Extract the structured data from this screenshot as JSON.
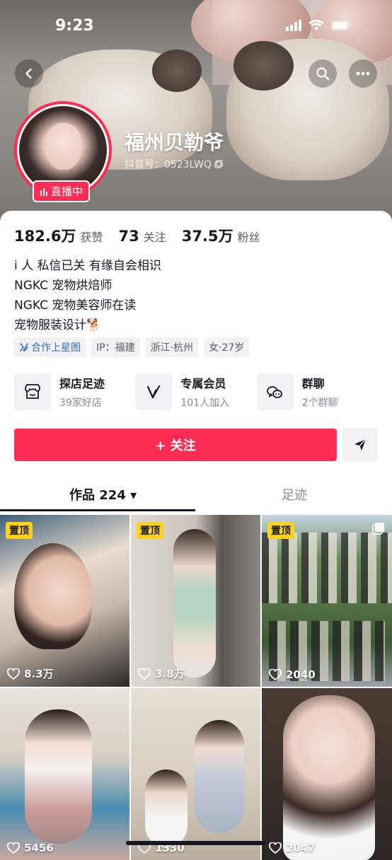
{
  "status_bar": {
    "time": "9:23"
  },
  "profile": {
    "nickname": "福州贝勒爷",
    "douyin_id": "抖音号：0523LWQ",
    "live_badge": "直播中"
  },
  "stats": [
    {
      "num": "182.6万",
      "label": "获赞"
    },
    {
      "num": "73",
      "label": "关注"
    },
    {
      "num": "37.5万",
      "label": "粉丝"
    }
  ],
  "bio": [
    "i 人  私信已关 有缘自会相识",
    "NGKC 宠物烘焙师",
    "NGKC 宠物美容师在读",
    "宠物服装设计🐕"
  ],
  "tags": {
    "partner": "合作上星图",
    "ip": "IP：福建",
    "location": "浙江·杭州",
    "gender_age": "女·27岁"
  },
  "services": [
    {
      "title": "探店足迹",
      "sub": "39家好店",
      "icon": "shop-icon"
    },
    {
      "title": "专属会员",
      "sub": "101人加入",
      "icon": "vip-icon"
    },
    {
      "title": "群聊",
      "sub": "2个群聊",
      "icon": "chat-icon"
    }
  ],
  "actions": {
    "follow": "+ 关注"
  },
  "tabs": {
    "works": "作品 224 ▾",
    "footprints": "足迹"
  },
  "videos": [
    {
      "pinned": "置顶",
      "likes": "8.3万"
    },
    {
      "pinned": "置顶",
      "likes": "3.8万"
    },
    {
      "pinned": "置顶",
      "likes": "2040"
    },
    {
      "pinned": "",
      "likes": "5456"
    },
    {
      "pinned": "",
      "likes": "1330"
    },
    {
      "pinned": "",
      "likes": "2047"
    }
  ],
  "colors": {
    "accent": "#fe2c55",
    "pin": "#ffd21e"
  }
}
